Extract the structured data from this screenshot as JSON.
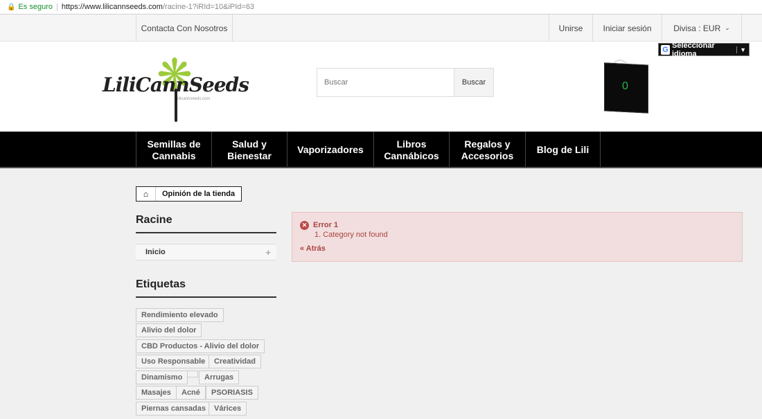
{
  "browser": {
    "secure_label": "Es seguro",
    "url_host": "https://www.lilicannseeds.com",
    "url_path": "/racine-1?iRId=10&iPId=63"
  },
  "topbar": {
    "contact": "Contacta Con Nosotros",
    "unirse": "Unirse",
    "login": "Iniciar sesión",
    "divisa": "Divisa : EUR"
  },
  "header": {
    "logo_text": "LiliCannSeeds",
    "logo_small": "lilicannseeds.com",
    "search_placeholder": "Buscar",
    "search_button": "Buscar",
    "cart_count": "0",
    "language_button": "Seleccionar idioma"
  },
  "nav": {
    "items": [
      {
        "line1": "Semillas de",
        "line2": "Cannabis"
      },
      {
        "line1": "Salud y",
        "line2": "Bienestar"
      },
      {
        "line1": "Vaporizadores",
        "line2": ""
      },
      {
        "line1": "Libros",
        "line2": "Cannábicos"
      },
      {
        "line1": "Regalos y",
        "line2": "Accesorios"
      },
      {
        "line1": "Blog de Lili",
        "line2": ""
      }
    ]
  },
  "breadcrumb": {
    "label": "Opinión de la tienda"
  },
  "sidebar": {
    "category_title": "Racine",
    "category_item": "Inicio",
    "tags_title": "Etiquetas",
    "tags": [
      "Rendimiento elevado",
      "Alivio del dolor",
      "CBD Productos - Alivio del dolor",
      "Uso Responsable",
      "Creatividad",
      "Dinamismo",
      "",
      "Arrugas",
      "Masajes",
      "Acné",
      "PSORIASIS",
      "Piernas cansadas",
      "Várices"
    ]
  },
  "error": {
    "title": "Error 1",
    "message": "1. Category not found",
    "back": "« Atrás"
  }
}
